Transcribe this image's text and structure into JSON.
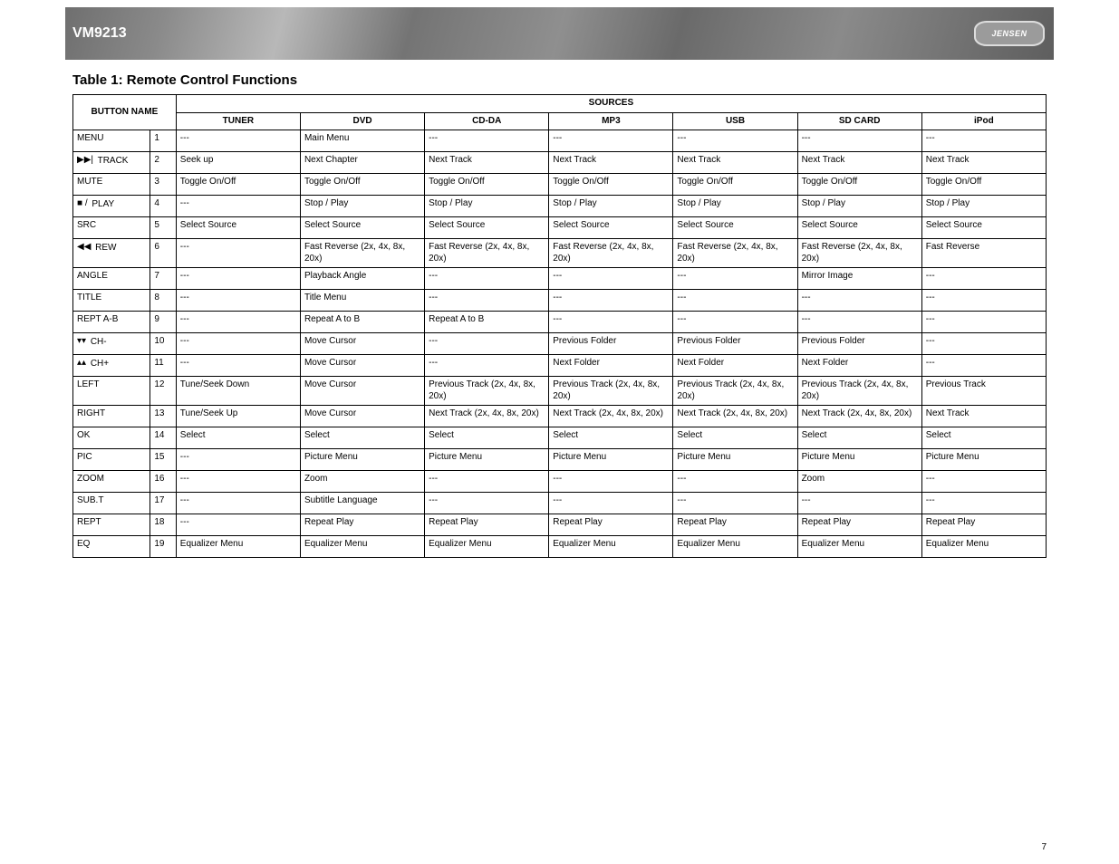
{
  "header": {
    "model": "VM9213",
    "brand": "JENSEN"
  },
  "title": "Table 1: Remote Control Functions",
  "page_number": "7",
  "columns": {
    "name": "BUTTON NAME",
    "sources": "SOURCES",
    "srcs": [
      "TUNER",
      "DVD",
      "CD-DA",
      "MP3",
      "USB",
      "SD CARD",
      "iPod"
    ]
  },
  "rows": [
    {
      "icon": "menu",
      "name": "MENU",
      "ref": "1",
      "c": [
        "---",
        "Main Menu",
        "---",
        "---",
        "---",
        "---",
        "---"
      ]
    },
    {
      "icon": "next-track",
      "name": "TRACK",
      "ref": "2",
      "c": [
        "Seek up",
        "Next Chapter",
        "Next Track",
        "Next Track",
        "Next Track",
        "Next Track",
        "Next Track"
      ]
    },
    {
      "icon": "mute",
      "name": "MUTE",
      "ref": "3",
      "c": [
        "Toggle On/Off",
        "Toggle On/Off",
        "Toggle On/Off",
        "Toggle On/Off",
        "Toggle On/Off",
        "Toggle On/Off",
        "Toggle On/Off"
      ]
    },
    {
      "icon": "stop-play",
      "name": "PLAY",
      "ref": "4",
      "c": [
        "---",
        "Stop / Play",
        "Stop / Play",
        "Stop / Play",
        "Stop / Play",
        "Stop / Play",
        "Stop / Play"
      ]
    },
    {
      "icon": "src",
      "name": "SRC",
      "ref": "5",
      "c": [
        "Select Source",
        "Select Source",
        "Select Source",
        "Select Source",
        "Select Source",
        "Select Source",
        "Select Source"
      ]
    },
    {
      "icon": "rew",
      "name": "REW",
      "ref": "6",
      "c": [
        "---",
        "Fast Reverse (2x, 4x, 8x, 20x)",
        "Fast Reverse (2x, 4x, 8x, 20x)",
        "Fast Reverse (2x, 4x, 8x, 20x)",
        "Fast Reverse (2x, 4x, 8x, 20x)",
        "Fast Reverse (2x, 4x, 8x, 20x)",
        "Fast Reverse"
      ]
    },
    {
      "icon": "angle",
      "name": "ANGLE",
      "ref": "7",
      "c": [
        "---",
        "Playback Angle",
        "---",
        "---",
        "---",
        "Mirror Image",
        "---"
      ]
    },
    {
      "icon": "title",
      "name": "TITLE",
      "ref": "8",
      "c": [
        "---",
        "Title Menu",
        "---",
        "---",
        "---",
        "---",
        "---"
      ]
    },
    {
      "icon": "repeat",
      "name": "REPT A-B",
      "ref": "9",
      "c": [
        "---",
        "Repeat A to B",
        "Repeat A to B",
        "---",
        "---",
        "---",
        "---"
      ]
    },
    {
      "icon": "chdown",
      "name": "CH-",
      "ref": "10",
      "c": [
        "---",
        "Move Cursor",
        "---",
        "Previous Folder",
        "Previous Folder",
        "Previous Folder",
        "---"
      ]
    },
    {
      "icon": "chup",
      "name": "CH+",
      "ref": "11",
      "c": [
        "---",
        "Move Cursor",
        "---",
        "Next Folder",
        "Next Folder",
        "Next Folder",
        "---"
      ]
    },
    {
      "icon": "left",
      "name": "LEFT",
      "ref": "12",
      "c": [
        "Tune/Seek Down",
        "Move Cursor",
        "Previous Track (2x, 4x, 8x, 20x)",
        "Previous Track (2x, 4x, 8x, 20x)",
        "Previous Track (2x, 4x, 8x, 20x)",
        "Previous Track (2x, 4x, 8x, 20x)",
        "Previous Track"
      ]
    },
    {
      "icon": "right",
      "name": "RIGHT",
      "ref": "13",
      "c": [
        "Tune/Seek Up",
        "Move Cursor",
        "Next Track (2x, 4x, 8x, 20x)",
        "Next Track (2x, 4x, 8x, 20x)",
        "Next Track (2x, 4x, 8x, 20x)",
        "Next Track (2x, 4x, 8x, 20x)",
        "Next Track"
      ]
    },
    {
      "icon": "ok",
      "name": "OK",
      "ref": "14",
      "c": [
        "Select",
        "Select",
        "Select",
        "Select",
        "Select",
        "Select",
        "Select"
      ]
    },
    {
      "icon": "pic",
      "name": "PIC",
      "ref": "15",
      "c": [
        "---",
        "Picture Menu",
        "Picture Menu",
        "Picture Menu",
        "Picture Menu",
        "Picture Menu",
        "Picture Menu"
      ]
    },
    {
      "icon": "zoom",
      "name": "ZOOM",
      "ref": "16",
      "c": [
        "---",
        "Zoom",
        "---",
        "---",
        "---",
        "Zoom",
        "---"
      ]
    },
    {
      "icon": "sub",
      "name": "SUB.T",
      "ref": "17",
      "c": [
        "---",
        "Subtitle Language",
        "---",
        "---",
        "---",
        "---",
        "---"
      ]
    },
    {
      "icon": "rept",
      "name": "REPT",
      "ref": "18",
      "c": [
        "---",
        "Repeat Play",
        "Repeat Play",
        "Repeat Play",
        "Repeat Play",
        "Repeat Play",
        "Repeat Play"
      ]
    },
    {
      "icon": "eq",
      "name": "EQ",
      "ref": "19",
      "c": [
        "Equalizer Menu",
        "Equalizer Menu",
        "Equalizer Menu",
        "Equalizer Menu",
        "Equalizer Menu",
        "Equalizer Menu",
        "Equalizer Menu"
      ]
    }
  ],
  "icons": {
    "menu": "",
    "next-track": "▶▶|",
    "mute": "",
    "stop-play": "■ /",
    "src": "",
    "rew": "◀◀",
    "angle": "",
    "title": "",
    "repeat": "",
    "chdown": "▾▾",
    "chup": "▴▴",
    "left": "",
    "right": "",
    "ok": "",
    "pic": "",
    "zoom": "",
    "sub": "",
    "rept": "",
    "eq": ""
  }
}
